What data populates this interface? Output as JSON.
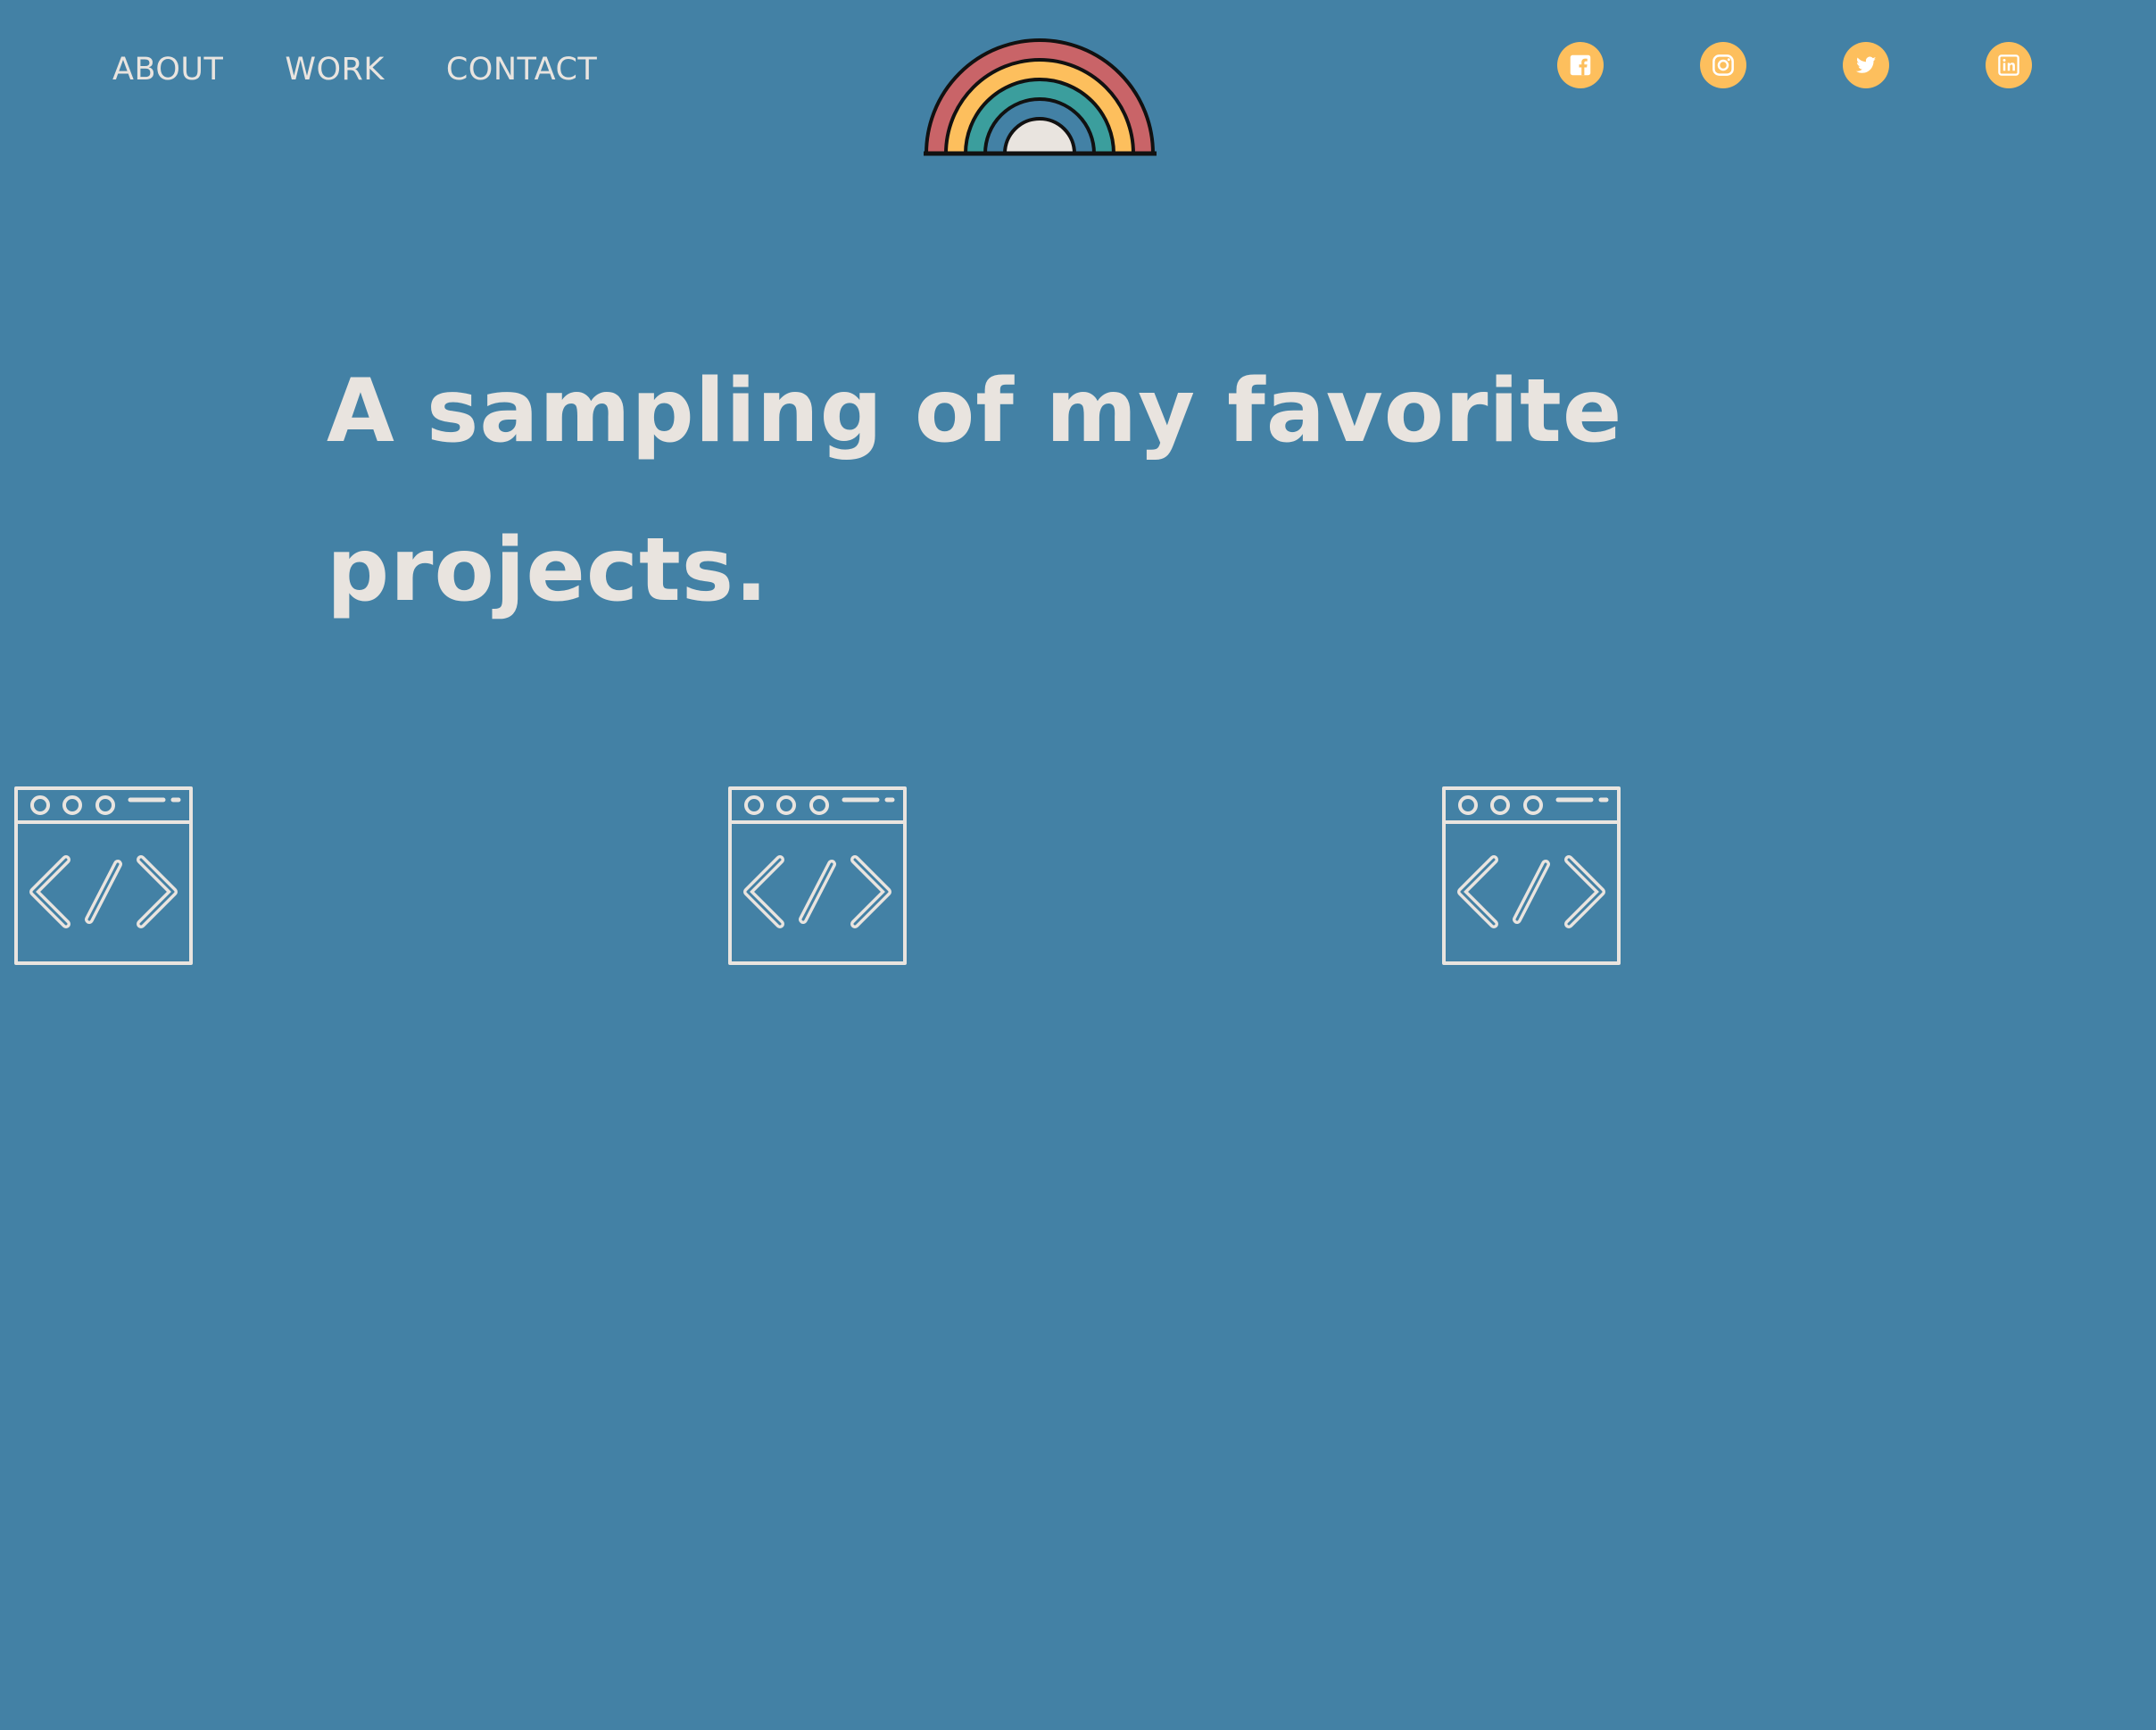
{
  "nav": {
    "items": [
      {
        "label": "ABOUT"
      },
      {
        "label": "WORK"
      },
      {
        "label": "CONTACT"
      }
    ]
  },
  "logo": {
    "icon": "rainbow-logo"
  },
  "social": {
    "icons": [
      "facebook-icon",
      "instagram-icon",
      "twitter-icon",
      "linkedin-icon"
    ]
  },
  "hero": {
    "heading": "A sampling of my favorite projects."
  },
  "projects": {
    "icon": "code-window-icon",
    "count_shown": 3
  },
  "colors": {
    "background": "#4381a5",
    "text": "#e9e4df",
    "accent": "#fdbf5d",
    "rainbow_red": "#c96468",
    "rainbow_yellow": "#fdbf5d",
    "rainbow_teal": "#3b9e9d",
    "rainbow_blue": "#4381a5"
  }
}
